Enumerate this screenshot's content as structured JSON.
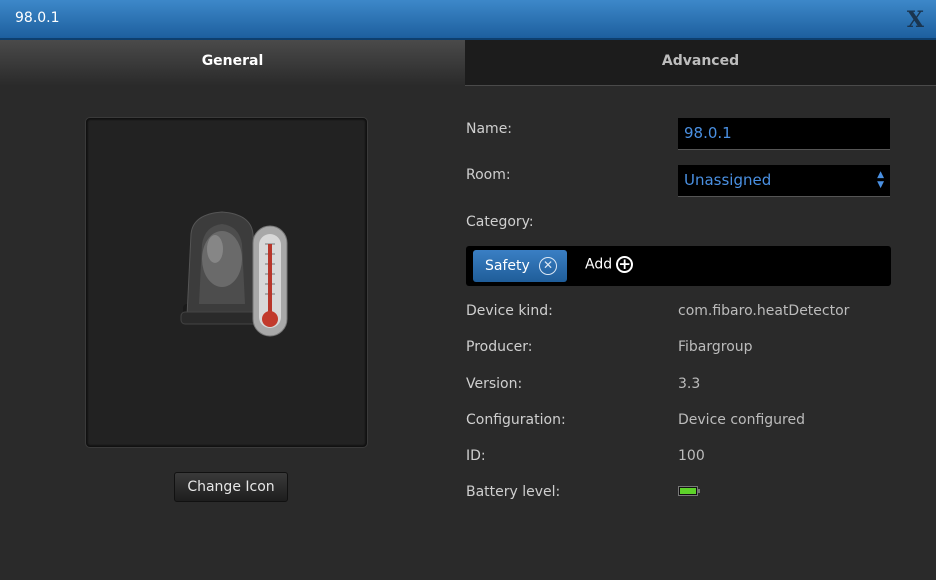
{
  "window": {
    "title": "98.0.1",
    "close_label": "X"
  },
  "tabs": [
    {
      "label": "General"
    },
    {
      "label": "Advanced"
    }
  ],
  "icon_panel": {
    "change_icon_label": "Change Icon",
    "icon": "heat-detector-icon"
  },
  "form": {
    "name_label": "Name:",
    "name_value": "98.0.1",
    "room_label": "Room:",
    "room_value": "Unassigned",
    "category_label": "Category:",
    "category_chip": "Safety",
    "add_label": "Add"
  },
  "details": [
    {
      "label": "Device kind:",
      "value": "com.fibaro.heatDetector"
    },
    {
      "label": "Producer:",
      "value": "Fibargroup"
    },
    {
      "label": "Version:",
      "value": "3.3"
    },
    {
      "label": "Configuration:",
      "value": "Device configured"
    },
    {
      "label": "ID:",
      "value": "100"
    },
    {
      "label": "Battery level:",
      "value": ""
    }
  ],
  "battery": {
    "level": 1.0,
    "color": "#5ed22a"
  },
  "colors": {
    "accent": "#4a90e2",
    "titlebar": "#2f79bd"
  }
}
